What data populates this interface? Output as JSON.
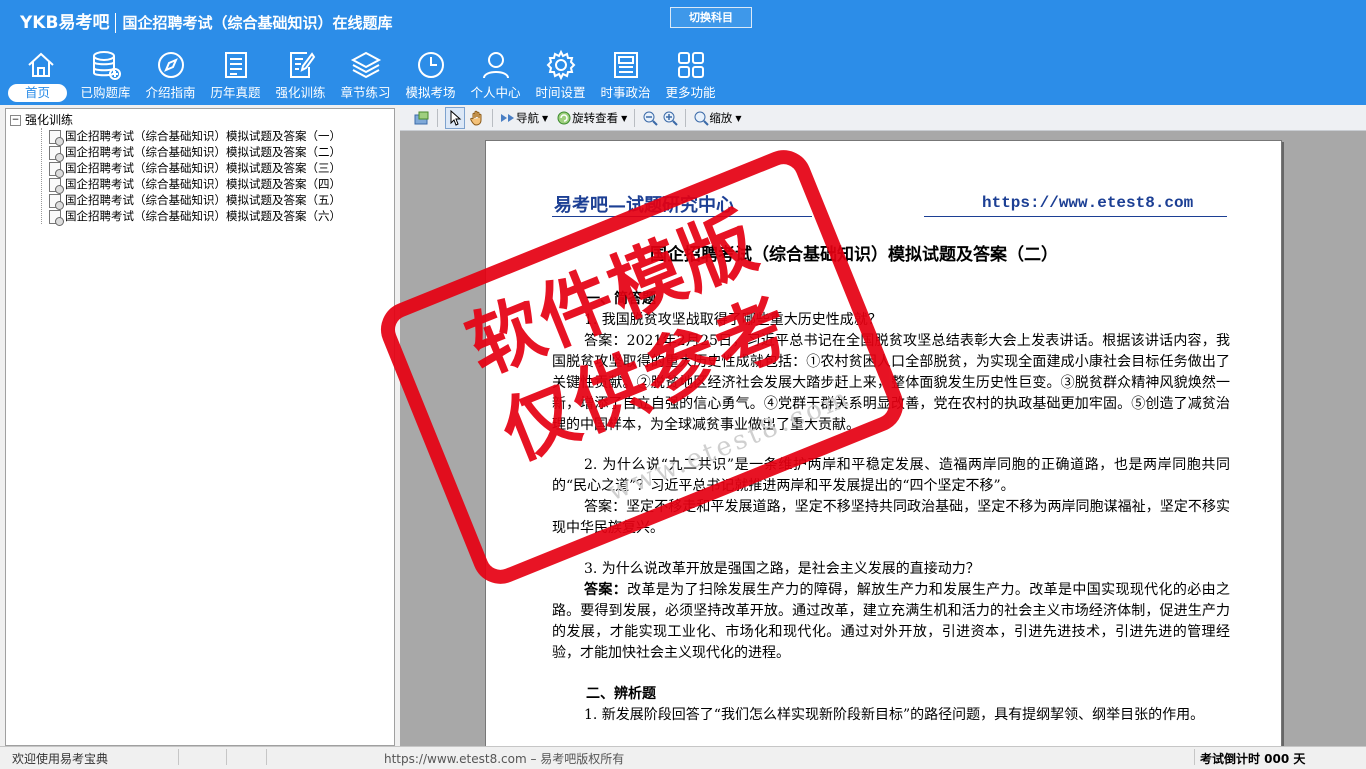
{
  "app": {
    "brand": "YKB易考吧",
    "title": "国企招聘考试（综合基础知识）在线题库",
    "switch_label": "切换科目"
  },
  "nav": [
    {
      "label": "首页",
      "icon": "home-icon"
    },
    {
      "label": "已购题库",
      "icon": "database-icon"
    },
    {
      "label": "介绍指南",
      "icon": "compass-icon"
    },
    {
      "label": "历年真题",
      "icon": "list-doc-icon"
    },
    {
      "label": "强化训练",
      "icon": "edit-doc-icon"
    },
    {
      "label": "章节练习",
      "icon": "layers-icon"
    },
    {
      "label": "模拟考场",
      "icon": "clock-icon"
    },
    {
      "label": "个人中心",
      "icon": "user-icon"
    },
    {
      "label": "时间设置",
      "icon": "gear-icon"
    },
    {
      "label": "时事政治",
      "icon": "news-icon"
    },
    {
      "label": "更多功能",
      "icon": "grid-icon"
    }
  ],
  "tree": {
    "root": "强化训练",
    "items": [
      "国企招聘考试（综合基础知识）模拟试题及答案（一）",
      "国企招聘考试（综合基础知识）模拟试题及答案（二）",
      "国企招聘考试（综合基础知识）模拟试题及答案（三）",
      "国企招聘考试（综合基础知识）模拟试题及答案（四）",
      "国企招聘考试（综合基础知识）模拟试题及答案（五）",
      "国企招聘考试（综合基础知识）模拟试题及答案（六）"
    ]
  },
  "toolbar": {
    "nav_label": "导航",
    "rotate_label": "旋转查看",
    "zoom_label": "缩放"
  },
  "doc": {
    "header_left": "易考吧—试题研究中心",
    "header_url": "https://www.etest8.com",
    "title": "国企招聘考试（综合基础知识）模拟试题及答案（二）",
    "section1": "一、简答题",
    "p1": "1. 我国脱贫攻坚战取得了哪些重大历史性成就？",
    "p2": "答案：2021年2月25日，习近平总书记在全国脱贫攻坚总结表彰大会上发表讲话。根据该讲话内容，我国脱贫攻坚取得的重大历史性成就包括：①农村贫困人口全部脱贫，为实现全面建成小康社会目标任务做出了关键性贡献。②脱贫地区经济社会发展大踏步赶上来，整体面貌发生历史性巨变。③脱贫群众精神风貌焕然一新，增添了自立自强的信心勇气。④党群干群关系明显改善，党在农村的执政基础更加牢固。⑤创造了减贫治理的中国样本，为全球减贫事业做出了重大贡献。",
    "p3": "2. 为什么说“九二共识”是一条维护两岸和平稳定发展、造福两岸同胞的正确道路，也是两岸同胞共同的“民心之道”？习近平总书记就推进两岸和平发展提出的“四个坚定不移”。",
    "p4": "答案：坚定不移走和平发展道路，坚定不移坚持共同政治基础，坚定不移为两岸同胞谋福祉，坚定不移实现中华民族复兴。",
    "p5": "3. 为什么说改革开放是强国之路，是社会主义发展的直接动力？",
    "p6_label": "答案：",
    "p6": "改革是为了扫除发展生产力的障碍，解放生产力和发展生产力。改革是中国实现现代化的必由之路。要得到发展，必须坚持改革开放。通过改革，建立充满生机和活力的社会主义市场经济体制，促进生产力的发展，才能实现工业化、市场化和现代化。通过对外开放，引进资本，引进先进技术，引进先进的管理经验，才能加快社会主义现代化的进程。",
    "section2": "二、辨析题",
    "p7": "1. 新发展阶段回答了“我们怎么样实现新阶段新目标”的路径问题，具有提纲挈领、纲举目张的作用。",
    "stamp_line1": "软件模版",
    "stamp_line2": "仅供参考",
    "watermark": "www.etest8.com"
  },
  "status": {
    "welcome": "欢迎使用易考宝典",
    "copyright": "https://www.etest8.com – 易考吧版权所有",
    "countdown": "考试倒计时 000 天"
  },
  "colors": {
    "header_bg": "#2c8de8",
    "stamp_red": "#e60012",
    "doc_header_blue": "#1c3f94"
  }
}
